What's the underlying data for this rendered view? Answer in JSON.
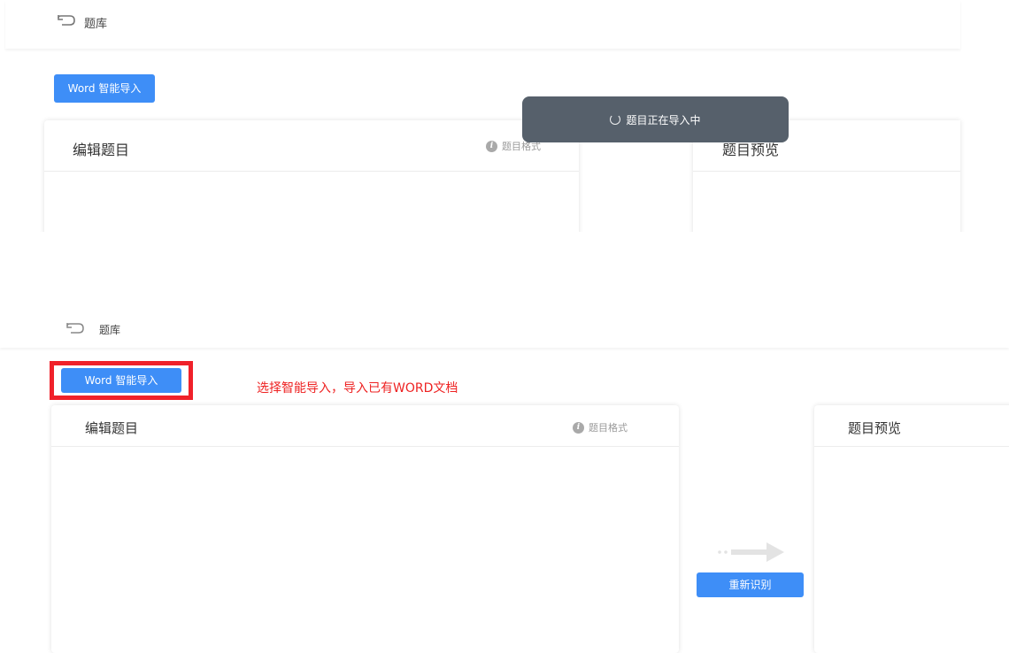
{
  "top": {
    "breadcrumb": "题库",
    "import_button": "Word 智能导入",
    "editor_title": "编辑题目",
    "format_link": "题目格式",
    "preview_title": "题目预览",
    "toast": "题目正在导入中"
  },
  "bottom": {
    "breadcrumb": "题库",
    "import_button": "Word 智能导入",
    "annotation": "选择智能导入，导入已有WORD文档",
    "editor_title": "编辑题目",
    "format_link": "题目格式",
    "preview_title": "题目预览",
    "recognize_button": "重新识别"
  },
  "colors": {
    "accent": "#3e8ef7",
    "highlight": "#f0212a",
    "annotation": "#ee2222",
    "toast_bg": "#56606b"
  },
  "icons": [
    "back-arrow-icon",
    "info-icon",
    "spinner-icon",
    "arrow-right-icon"
  ]
}
